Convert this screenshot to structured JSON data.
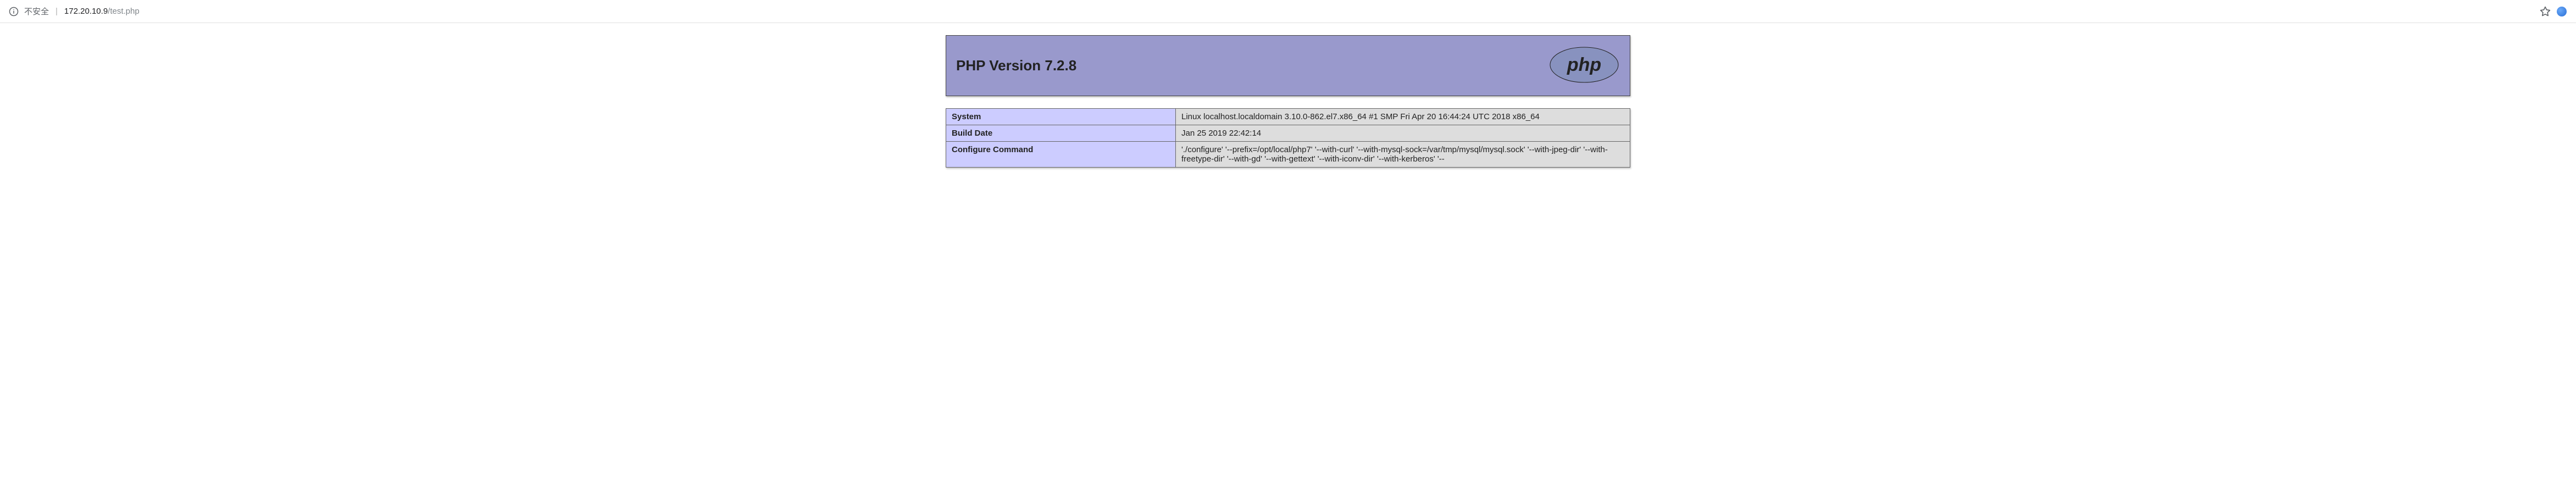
{
  "urlbar": {
    "security_label": "不安全",
    "host": "172.20.10.9",
    "path": "/test.php"
  },
  "header": {
    "title": "PHP Version 7.2.8",
    "logo_text": "php"
  },
  "rows": [
    {
      "key": "System",
      "value": "Linux localhost.localdomain 3.10.0-862.el7.x86_64 #1 SMP Fri Apr 20 16:44:24 UTC 2018 x86_64"
    },
    {
      "key": "Build Date",
      "value": "Jan 25 2019 22:42:14"
    },
    {
      "key": "Configure Command",
      "value": "'./configure' '--prefix=/opt/local/php7' '--with-curl' '--with-mysql-sock=/var/tmp/mysql/mysql.sock' '--with-jpeg-dir' '--with-freetype-dir' '--with-gd' '--with-gettext' '--with-iconv-dir' '--with-kerberos' '--"
    }
  ]
}
